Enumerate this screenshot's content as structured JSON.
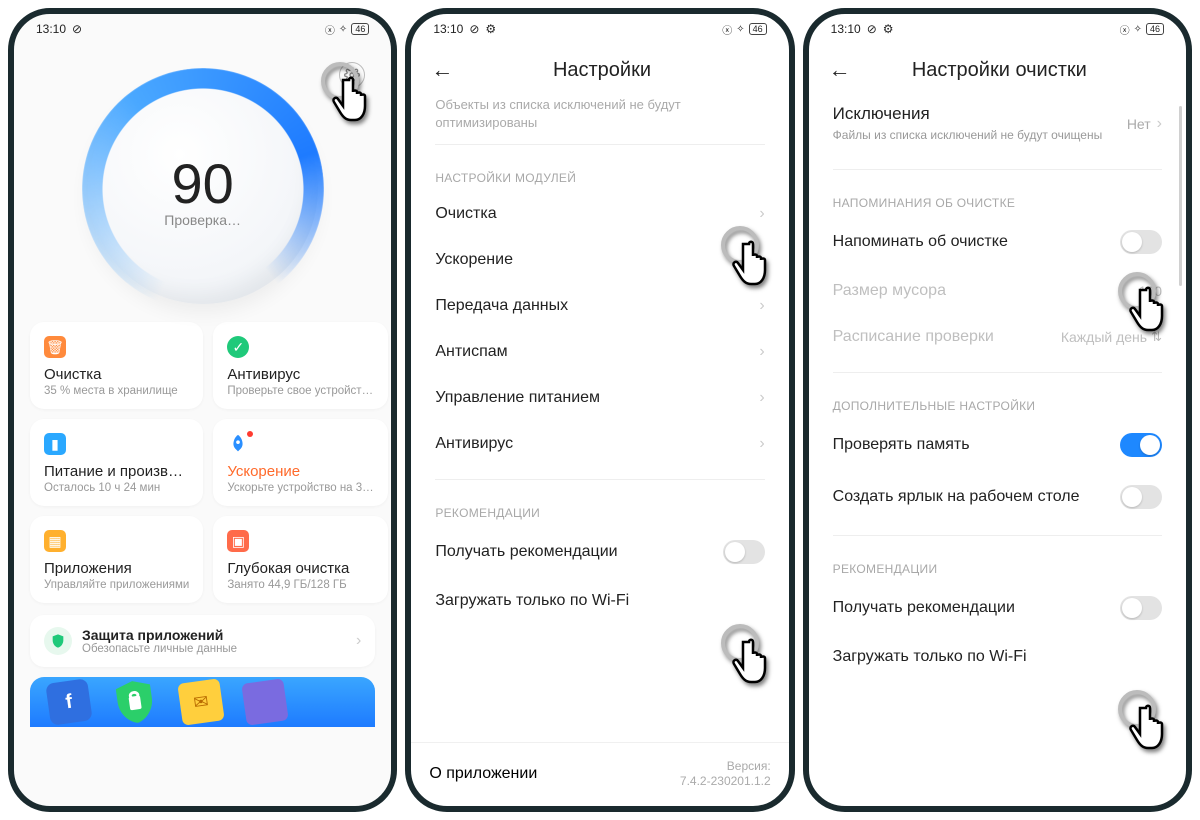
{
  "status": {
    "time": "13:10",
    "battery": "46"
  },
  "phone1": {
    "score": "90",
    "score_label": "Проверка…",
    "tiles": [
      {
        "title": "Очистка",
        "sub": "35 % места в хранилище"
      },
      {
        "title": "Антивирус",
        "sub": "Проверьте свое устройст…"
      },
      {
        "title": "Питание и произв…",
        "sub": "Осталось 10 ч 24 мин"
      },
      {
        "title": "Ускорение",
        "sub": "Ускорьте устройство на 3…"
      },
      {
        "title": "Приложения",
        "sub": "Управляйте приложениями"
      },
      {
        "title": "Глубокая очистка",
        "sub": "Занято 44,9 ГБ/128 ГБ"
      }
    ],
    "protect_title": "Защита приложений",
    "protect_sub": "Обезопасьте личные данные"
  },
  "phone2": {
    "title": "Настройки",
    "cut1": "Объекты из списка исключений не будут",
    "cut2": "оптимизированы",
    "sec_modules": "НАСТРОЙКИ МОДУЛЕЙ",
    "rows": {
      "clean": "Очистка",
      "boost": "Ускорение",
      "data": "Передача данных",
      "spam": "Антиспам",
      "power": "Управление питанием",
      "av": "Антивирус"
    },
    "sec_rec": "РЕКОМЕНДАЦИИ",
    "rec1": "Получать рекомендации",
    "rec2": "Загружать только по Wi-Fi",
    "about": "О приложении",
    "ver_label": "Версия:",
    "ver_val": "7.4.2-230201.1.2"
  },
  "phone3": {
    "title": "Настройки очистки",
    "excl_title": "Исключения",
    "excl_sub": "Файлы из списка исключений не будут очищены",
    "excl_val": "Нет",
    "sec_remind": "НАПОМИНАНИЯ ОБ ОЧИСТКЕ",
    "remind": "Напоминать об очистке",
    "trash_label": "Размер мусора",
    "trash_val": "100",
    "sched_label": "Расписание проверки",
    "sched_val": "Каждый день",
    "sec_extra": "ДОПОЛНИТЕЛЬНЫЕ НАСТРОЙКИ",
    "mem": "Проверять память",
    "shortcut": "Создать ярлык на рабочем столе",
    "sec_rec": "РЕКОМЕНДАЦИИ",
    "rec1": "Получать рекомендации",
    "rec2": "Загружать только по Wi-Fi"
  }
}
